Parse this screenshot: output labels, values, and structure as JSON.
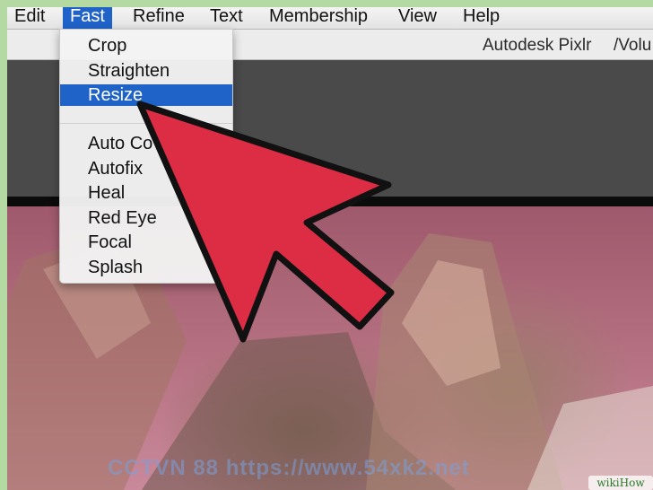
{
  "menubar": {
    "items": [
      {
        "label": "Edit"
      },
      {
        "label": "Fast"
      },
      {
        "label": "Refine"
      },
      {
        "label": "Text"
      },
      {
        "label": "Membership"
      },
      {
        "label": "View"
      },
      {
        "label": "Help"
      }
    ]
  },
  "titlebar": {
    "app_name": "Autodesk Pixlr",
    "path_fragment": "/Volu"
  },
  "fast_menu": {
    "group1": [
      "Crop",
      "Straighten",
      "Resize"
    ],
    "selected": "Resize",
    "group2": [
      "Auto Co",
      "Autofix",
      "Heal",
      "Red Eye",
      "Focal",
      "Splash"
    ]
  },
  "overlay": {
    "pointer": "large-red-arrow",
    "pointer_color": "#dc2d44",
    "watermark_text": "CCTVN 88  https://www.54xk2.net",
    "badge": "wikiHow"
  },
  "colors": {
    "menu_highlight": "#1f62c8",
    "photo_tint": "#b26d7e"
  }
}
